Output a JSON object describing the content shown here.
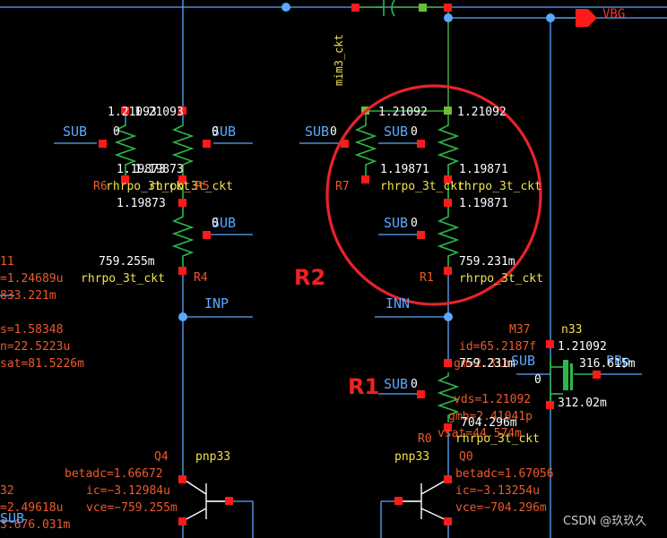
{
  "colors": {
    "background": "#000000",
    "wire_blue": "#5aa8ff",
    "wire_green": "#46c64a",
    "device_green": "#2db84a",
    "pin_red": "#ff1a1a",
    "highlight_circle": "#e8232a",
    "label_white": "#ffffff",
    "label_yellow": "#f2e14a",
    "label_orange": "#ee5a2a",
    "annotation_red": "#ee2222",
    "pin_flag_red": "#ff1a1a"
  },
  "icons": {
    "pin_flag": "arrow-pin-icon",
    "resistor": "zigzag-resistor-icon",
    "capacitor": "mim-capacitor-icon",
    "pnp": "pnp-transistor-icon",
    "nmos": "nmos-transistor-icon",
    "node_dot": "node-dot-icon",
    "terminal": "red-terminal-square-icon"
  },
  "labels": {
    "vbg": "VBG",
    "mim3": "mim3_ckt",
    "sub1": "SUB",
    "sub2": "SUB",
    "sub3": "SUB",
    "sub4": "SUB",
    "sub5": "SUB",
    "sub6": "SUB",
    "sub7": "SUB",
    "sub8": "SUB",
    "inp": "INP",
    "inn": "INN",
    "r2": "R2",
    "r1": "R1",
    "m37": "M37",
    "n33": "n33",
    "pbp": "PBp",
    "lr_top_overlap": "1.21093",
    "l_mid": "1.19873",
    "l_mid2": "1.19873",
    "l_rhr_overlap": "rhrpo_3t_ckt",
    "l_r4": "R4",
    "l_759": "759.255m",
    "l_rhr3": "rhrpo_3t_ckt",
    "l_r_red": "R6",
    "l_r_red2": "R5",
    "v_top_a": "1.21092",
    "v_top_b": "1.21092",
    "v_mid_a": "1.19871",
    "v_mid_b": "1.19871",
    "v_mid_c": "1.19871",
    "r7": "R7",
    "rhr_a": "rhrpo_3t_ckt",
    "rhr_b": "rhrpo_3t_ckt",
    "r1_lbl": "R1",
    "v759": "759.231m",
    "rhr_c": "rhrpo_3t_ckt",
    "rhr_d": "rhrpo_3t_ckt",
    "r0": "R0",
    "v704": "704.296m",
    "vsat_overlap": "vsat=44.574m",
    "id": "id=65.2187f",
    "gm": "gm=2.31n",
    "vds": "vds=1.21092",
    "gmb": "gmb=2.41041p",
    "m37_v": "1.21092",
    "m37_z": "0",
    "v316": "316.615m",
    "v312": "312.02m",
    "v759b": "759.231m",
    "q4": "Q4",
    "pnp33a": "pnp33",
    "q0": "Q0",
    "pnp33b": "pnp33",
    "betadc_a": "betadc=1.66672",
    "ic_a": "ic=−3.12984u",
    "vce_a": "vce=−759.255m",
    "betadc_b": "betadc=1.67056",
    "ic_b": "ic=−3.13254u",
    "vce_b": "vce=−704.296m",
    "lft_11": "11",
    "lft_1": "=1.24689u",
    "lft_2": "833.221m",
    "lft_3": "s=1.58348",
    "lft_4": "n=22.5223u",
    "lft_5": "sat=81.5226m",
    "lft_32": "32",
    "lft_6": "=2.49618u",
    "lft_7": "3.676.031m",
    "lft_sub": "SUB",
    "z1": "0",
    "z2": "0",
    "z3": "0",
    "z4": "0",
    "z5": "0",
    "z6": "0",
    "z7": "0",
    "watermark": "CSDN @玖玖久"
  }
}
